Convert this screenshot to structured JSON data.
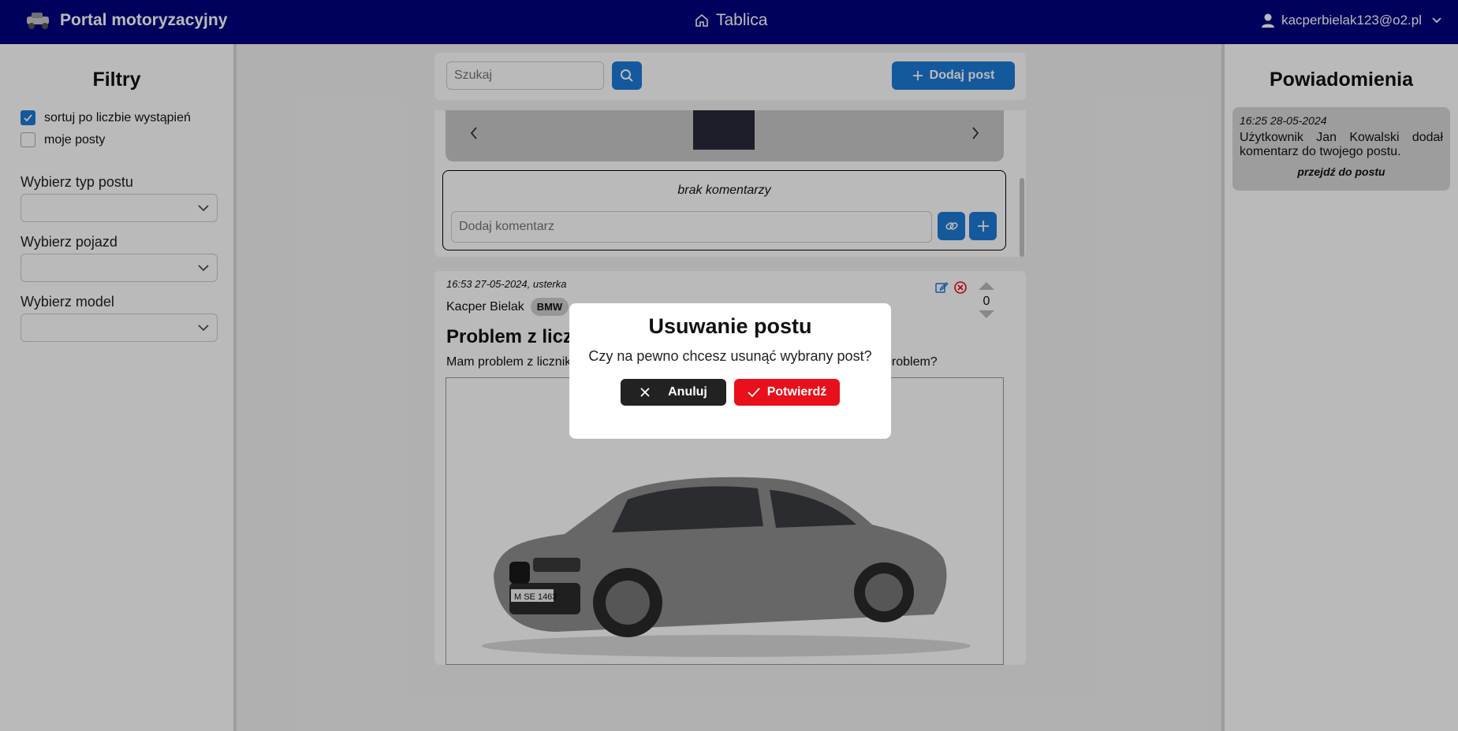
{
  "navbar": {
    "brand": "Portal motoryzacyjny",
    "center_link": "Tablica",
    "user_email": "kacperbielak123@o2.pl"
  },
  "filters": {
    "title": "Filtry",
    "checkboxes": [
      {
        "label": "sortuj po liczbie wystąpień",
        "checked": true
      },
      {
        "label": "moje posty",
        "checked": false
      }
    ],
    "selects": [
      {
        "label": "Wybierz typ postu",
        "value": ""
      },
      {
        "label": "Wybierz pojazd",
        "value": ""
      },
      {
        "label": "Wybierz model",
        "value": ""
      }
    ]
  },
  "toolbar": {
    "search_placeholder": "Szukaj",
    "add_post_label": "Dodaj post"
  },
  "post1": {
    "no_comments": "brak komentarzy",
    "comment_placeholder": "Dodaj komentarz"
  },
  "post2": {
    "meta": "16:53 27-05-2024, usterka",
    "author": "Kacper Bielak",
    "brand": "BMW",
    "title": "Problem z licz",
    "text_start": "Mam problem z licznik",
    "text_end": "problem?",
    "votes": "0",
    "plate": "M SE 1463"
  },
  "notifications": {
    "title": "Powiadomienia",
    "items": [
      {
        "time": "16:25 28-05-2024",
        "text": "Użytkownik Jan Kowalski dodał komentarz do twojego postu.",
        "link": "przejdź do postu"
      }
    ]
  },
  "modal": {
    "title": "Usuwanie postu",
    "message": "Czy na pewno chcesz usunąć wybrany post?",
    "cancel_label": "Anuluj",
    "confirm_label": "Potwierdź"
  },
  "colors": {
    "navbar": "#000080",
    "primary": "#1e7ad8",
    "danger": "#e8101a",
    "dark": "#222222"
  }
}
